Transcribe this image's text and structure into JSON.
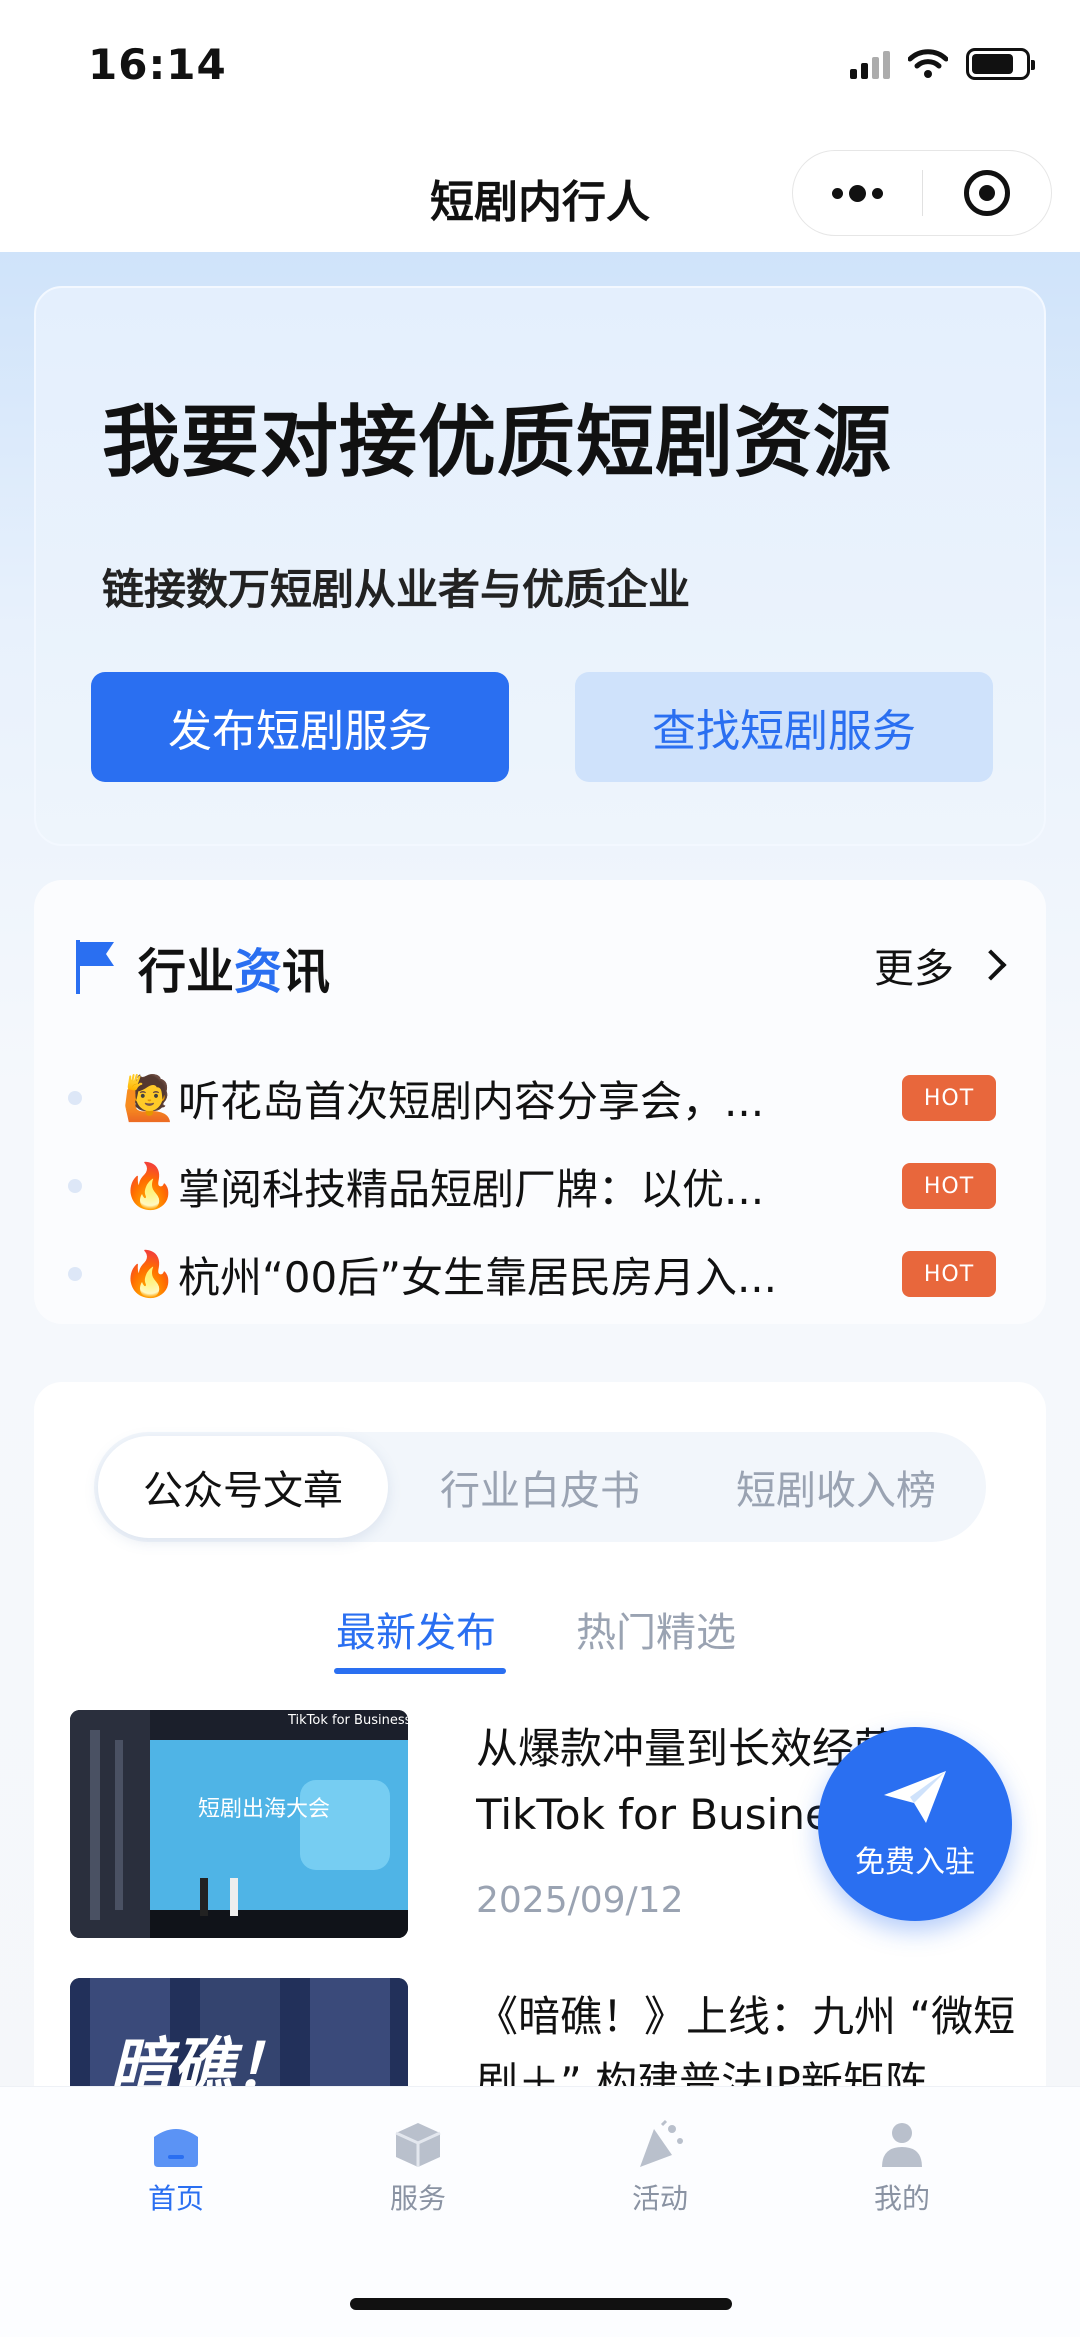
{
  "status_bar": {
    "time": "16:14"
  },
  "nav": {
    "title": "短剧内行人"
  },
  "hero": {
    "title": "我要对接优质短剧资源",
    "subtitle": "链接数万短剧从业者与优质企业",
    "primary_button": "发布短剧服务",
    "secondary_button": "查找短剧服务"
  },
  "news": {
    "title_part1": "行业",
    "title_accent": "资",
    "title_part2": "讯",
    "more_label": "更多",
    "items": [
      {
        "emoji": "🙋",
        "text": "听花岛首次短剧内容分享会，...",
        "badge": "HOT"
      },
      {
        "emoji": "🔥",
        "text": "掌阅科技精品短剧厂牌：以优...",
        "badge": "HOT"
      },
      {
        "emoji": "🔥",
        "text": "杭州“00后”女生靠居民房月入...",
        "badge": "HOT"
      }
    ]
  },
  "content": {
    "segments": [
      "公众号文章",
      "行业白皮书",
      "短剧收入榜"
    ],
    "active_segment": "公众号文章",
    "subtabs": [
      "最新发布",
      "热门精选"
    ],
    "active_subtab": "最新发布",
    "articles": [
      {
        "title": "从爆款冲量到长效经营：TikTok for Business",
        "date": "2025/09/12",
        "thumb_text": "短剧出海大会",
        "thumb_brand": "TikTok for Business"
      },
      {
        "title": "《暗礁！》上线：九州 “微短剧＋” 构建普法IP新矩阵",
        "date": "",
        "thumb_text": "暗礁！",
        "thumb_brand": ""
      }
    ]
  },
  "fab": {
    "label": "免费入驻"
  },
  "tabbar": {
    "items": [
      {
        "label": "首页",
        "icon": "home-icon",
        "active": true
      },
      {
        "label": "服务",
        "icon": "box-icon",
        "active": false
      },
      {
        "label": "活动",
        "icon": "party-icon",
        "active": false
      },
      {
        "label": "我的",
        "icon": "user-icon",
        "active": false
      }
    ]
  },
  "colors": {
    "accent": "#2a6ff1",
    "hot_badge": "#e8673c",
    "inactive": "#9aa3b2"
  }
}
